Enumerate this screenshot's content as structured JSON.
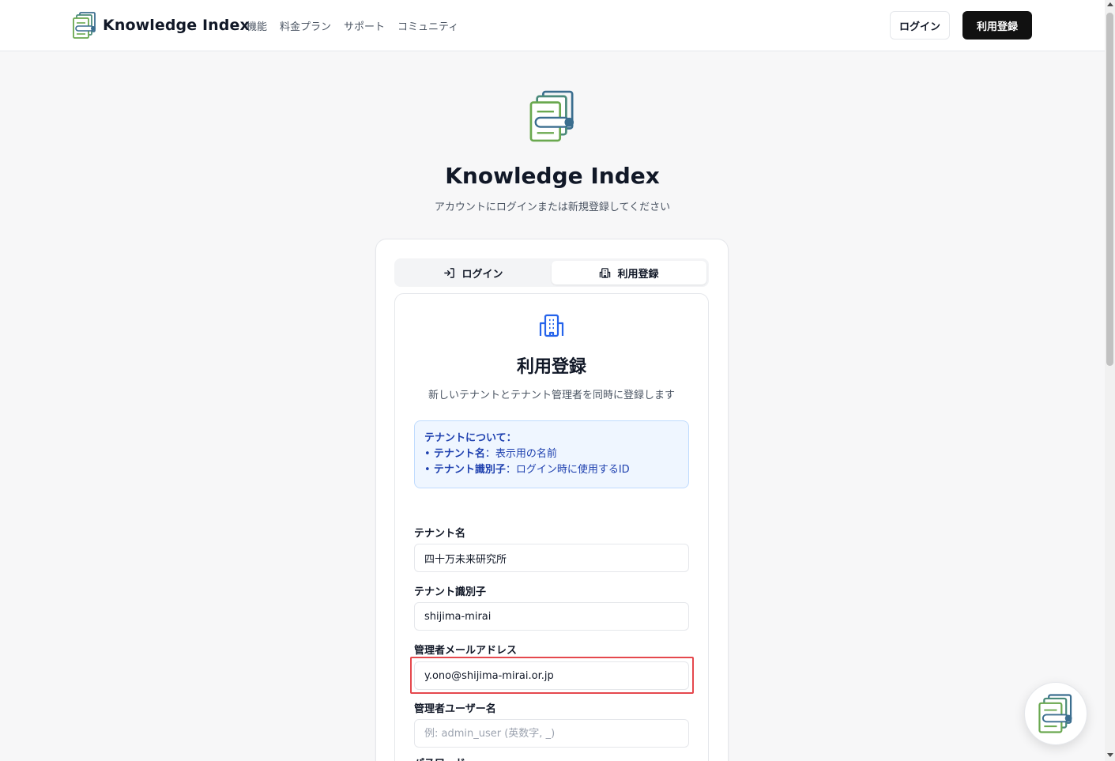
{
  "header": {
    "brand": "Knowledge Index",
    "nav": [
      "機能",
      "料金プラン",
      "サポート",
      "コミュニティ"
    ],
    "login_label": "ログイン",
    "register_label": "利用登録"
  },
  "hero": {
    "title": "Knowledge Index",
    "subtitle": "アカウントにログインまたは新規登録してください"
  },
  "tabs": {
    "login": "ログイン",
    "register": "利用登録",
    "active": "register"
  },
  "card": {
    "title": "利用登録",
    "subtitle": "新しいテナントとテナント管理者を同時に登録します"
  },
  "info": {
    "heading": "テナントについて：",
    "items": [
      {
        "term": "テナント名",
        "desc": "：表示用の名前"
      },
      {
        "term": "テナント識別子",
        "desc": "：ログイン時に使用するID"
      }
    ]
  },
  "form": {
    "tenant_name": {
      "label": "テナント名",
      "value": "四十万未来研究所"
    },
    "tenant_id": {
      "label": "テナント識別子",
      "value": "shijima-mirai"
    },
    "admin_email": {
      "label": "管理者メールアドレス",
      "value": "y.ono@shijima-mirai.or.jp"
    },
    "admin_username": {
      "label": "管理者ユーザー名",
      "value": "",
      "placeholder": "例: admin_user (英数字, _)"
    },
    "next_label": "パスワード"
  },
  "colors": {
    "primary": "#111111",
    "info_bg": "#eff6ff",
    "info_text": "#1e40af",
    "icon_blue": "#2563eb",
    "highlight": "#e5484d"
  }
}
